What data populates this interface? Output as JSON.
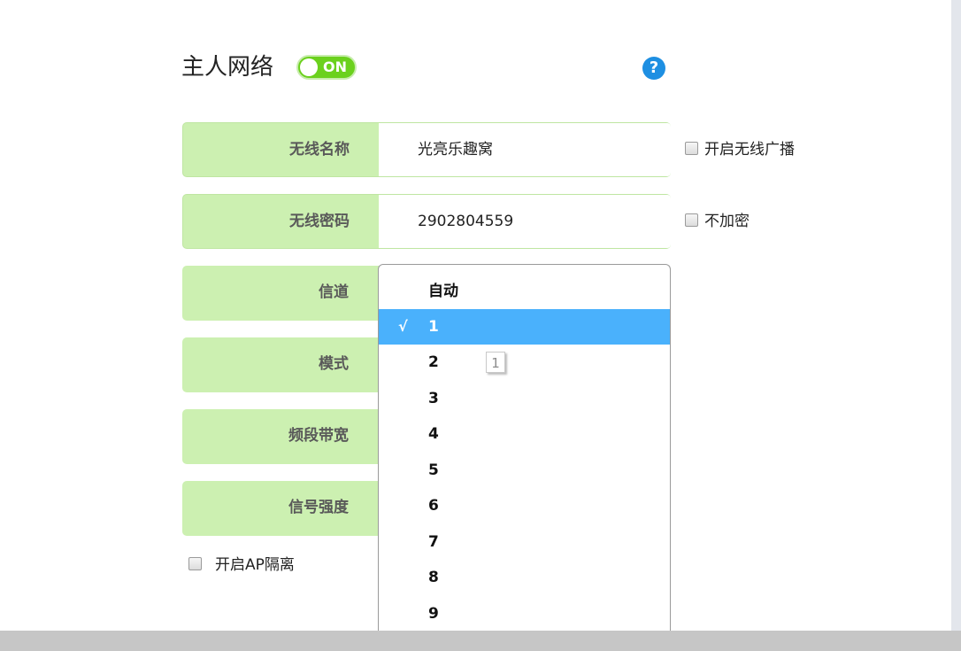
{
  "header": {
    "title": "主人网络",
    "toggle_label": "ON",
    "help_icon": "question-circle-icon",
    "help_glyph": "?"
  },
  "colors": {
    "accent_green": "#6bd11d",
    "row_green": "#ccf0b1",
    "selected_blue": "#4ab1fc",
    "help_blue": "#1e8fe2"
  },
  "form": {
    "ssid": {
      "label": "无线名称",
      "value": "光亮乐趣窝",
      "option_label": "开启无线广播",
      "option_checked": false
    },
    "password": {
      "label": "无线密码",
      "value": "2902804559",
      "option_label": "不加密",
      "option_checked": false
    },
    "channel": {
      "label": "信道"
    },
    "mode": {
      "label": "模式"
    },
    "bandwidth": {
      "label": "频段带宽"
    },
    "signal": {
      "label": "信号强度"
    },
    "ap_isolation": {
      "label": "开启AP隔离",
      "checked": false
    }
  },
  "channel_dropdown": {
    "check_mark": "√",
    "options": [
      "自动",
      "1",
      "2",
      "3",
      "4",
      "5",
      "6",
      "7",
      "8",
      "9"
    ],
    "selected": "1"
  },
  "tooltip": {
    "text": "1"
  }
}
